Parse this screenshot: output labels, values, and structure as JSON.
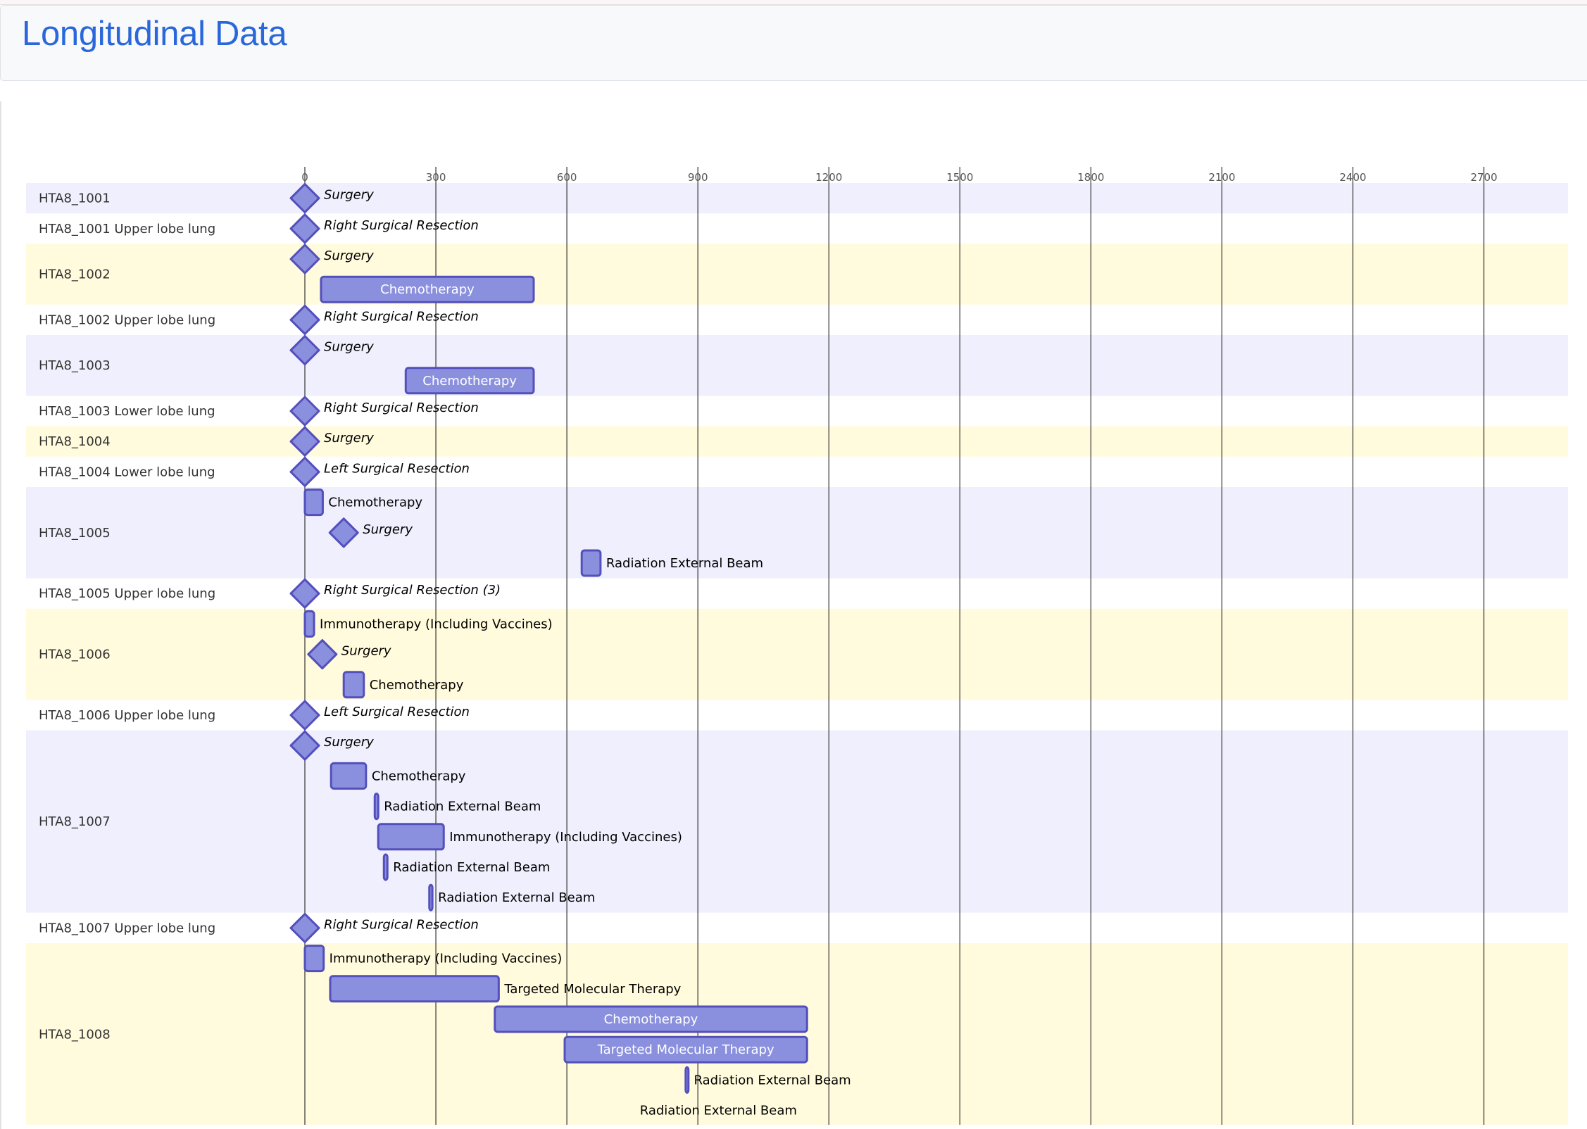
{
  "page": {
    "title": "Longitudinal Data"
  },
  "colors": {
    "title": "#2a67dc",
    "band_odd": "#efeffd",
    "band_even": "#fffbdc",
    "band_plain": "#ffffff",
    "task_fill": "#8a90dd",
    "task_stroke": "#534fbc",
    "grid": "#333333"
  },
  "chart_data": {
    "type": "gantt",
    "title": "Longitudinal Data",
    "xlabel": "",
    "ylabel": "",
    "x_unit": "days",
    "xlim": [
      0,
      2760
    ],
    "ticks": [
      0,
      300,
      600,
      900,
      1200,
      1500,
      1800,
      2100,
      2400,
      2700
    ],
    "grid": true,
    "sections": [
      {
        "name": "HTA8_1001",
        "band": "odd",
        "tasks": [
          {
            "label": "Surgery",
            "type": "milestone",
            "start": 0
          }
        ]
      },
      {
        "name": "HTA8_1001 Upper lobe lung",
        "band": "plain",
        "tasks": [
          {
            "label": "Right Surgical Resection",
            "type": "milestone",
            "start": 0
          }
        ]
      },
      {
        "name": "HTA8_1002",
        "band": "even",
        "tasks": [
          {
            "label": "Surgery",
            "type": "milestone",
            "start": 0
          },
          {
            "label": "Chemotherapy",
            "type": "task",
            "start": 37,
            "end": 524
          }
        ]
      },
      {
        "name": "HTA8_1002 Upper lobe lung",
        "band": "plain",
        "tasks": [
          {
            "label": "Right Surgical Resection",
            "type": "milestone",
            "start": 0
          }
        ]
      },
      {
        "name": "HTA8_1003",
        "band": "odd",
        "tasks": [
          {
            "label": "Surgery",
            "type": "milestone",
            "start": 0
          },
          {
            "label": "Chemotherapy",
            "type": "task",
            "start": 231,
            "end": 524
          }
        ]
      },
      {
        "name": "HTA8_1003 Lower lobe lung",
        "band": "plain",
        "tasks": [
          {
            "label": "Right Surgical Resection",
            "type": "milestone",
            "start": 0
          }
        ]
      },
      {
        "name": "HTA8_1004",
        "band": "even",
        "tasks": [
          {
            "label": "Surgery",
            "type": "milestone",
            "start": 0
          }
        ]
      },
      {
        "name": "HTA8_1004 Lower lobe lung",
        "band": "plain",
        "tasks": [
          {
            "label": "Left Surgical Resection",
            "type": "milestone",
            "start": 0
          }
        ]
      },
      {
        "name": "HTA8_1005",
        "band": "odd",
        "tasks": [
          {
            "label": "Chemotherapy",
            "type": "task",
            "start": 0,
            "end": 41
          },
          {
            "label": "Surgery",
            "type": "milestone",
            "start": 89
          },
          {
            "label": "Radiation External Beam",
            "type": "task",
            "start": 634,
            "end": 677
          }
        ]
      },
      {
        "name": "HTA8_1005 Upper lobe lung",
        "band": "plain",
        "tasks": [
          {
            "label": "Right Surgical Resection (3)",
            "type": "milestone",
            "start": 0
          }
        ]
      },
      {
        "name": "HTA8_1006",
        "band": "even",
        "tasks": [
          {
            "label": "Immunotherapy (Including Vaccines)",
            "type": "task",
            "start": 0,
            "end": 21
          },
          {
            "label": "Surgery",
            "type": "milestone",
            "start": 40
          },
          {
            "label": "Chemotherapy",
            "type": "task",
            "start": 89,
            "end": 135
          }
        ]
      },
      {
        "name": "HTA8_1006 Upper lobe lung",
        "band": "plain",
        "tasks": [
          {
            "label": "Left Surgical Resection",
            "type": "milestone",
            "start": 0
          }
        ]
      },
      {
        "name": "HTA8_1007",
        "band": "odd",
        "tasks": [
          {
            "label": "Surgery",
            "type": "milestone",
            "start": 0
          },
          {
            "label": "Chemotherapy",
            "type": "task",
            "start": 60,
            "end": 140
          },
          {
            "label": "Radiation External Beam",
            "type": "task",
            "start": 160,
            "end": 168
          },
          {
            "label": "Immunotherapy (Including Vaccines)",
            "type": "task",
            "start": 168,
            "end": 318
          },
          {
            "label": "Radiation External Beam",
            "type": "task",
            "start": 181,
            "end": 189
          },
          {
            "label": "Radiation External Beam",
            "type": "task",
            "start": 285,
            "end": 292
          }
        ]
      },
      {
        "name": "HTA8_1007 Upper lobe lung",
        "band": "plain",
        "tasks": [
          {
            "label": "Right Surgical Resection",
            "type": "milestone",
            "start": 0
          }
        ]
      },
      {
        "name": "HTA8_1008",
        "band": "even",
        "tasks": [
          {
            "label": "Immunotherapy (Including Vaccines)",
            "type": "task",
            "start": 0,
            "end": 43
          },
          {
            "label": "Targeted Molecular Therapy",
            "type": "task",
            "start": 58,
            "end": 444
          },
          {
            "label": "Chemotherapy",
            "type": "task",
            "start": 435,
            "end": 1150
          },
          {
            "label": "Targeted Molecular Therapy",
            "type": "task",
            "start": 595,
            "end": 1150
          },
          {
            "label": "Radiation External Beam",
            "type": "task",
            "start": 872,
            "end": 878
          },
          {
            "label": "Radiation External Beam",
            "type": "task",
            "start": 947,
            "end": 947
          }
        ]
      }
    ]
  }
}
